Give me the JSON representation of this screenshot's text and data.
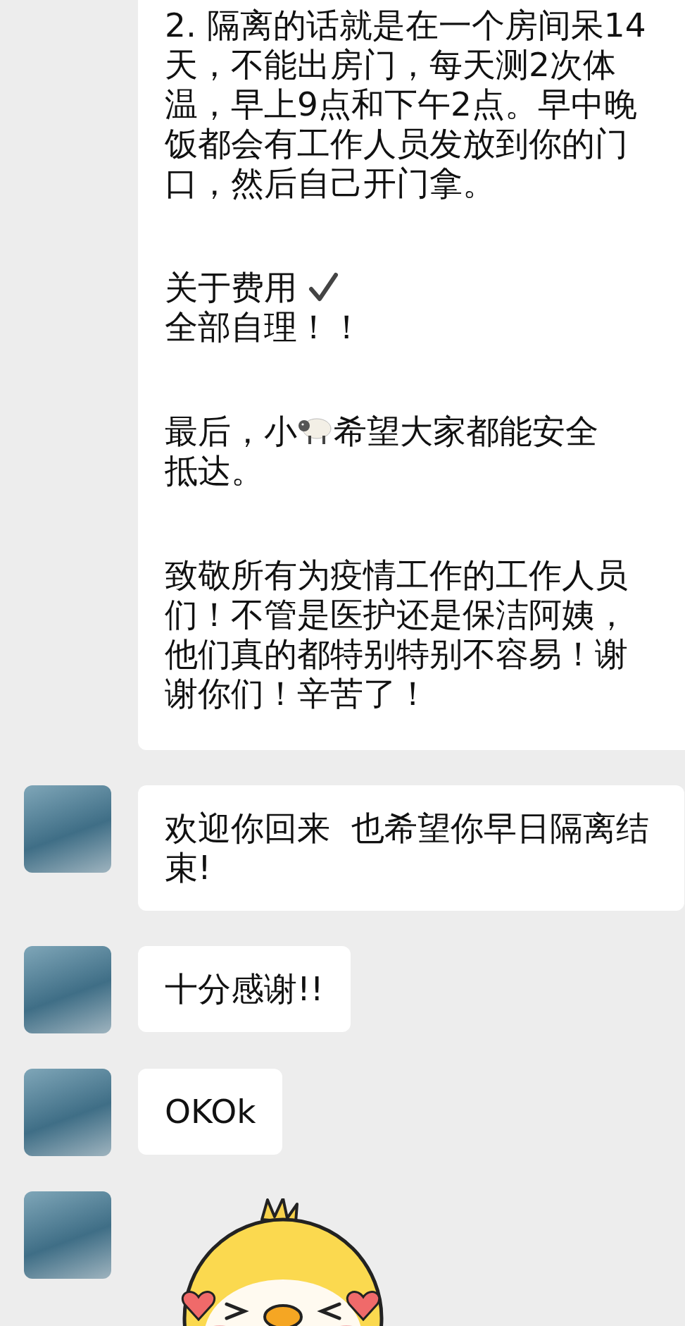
{
  "messages": [
    {
      "kind": "continued",
      "paragraphs": [
        {
          "lines": [
            {
              "kind": "text",
              "text": "2. 隔离的话就是在一个房间呆14天，不能出房门，每天测2次体温，早上9点和下午2点。早中晚饭都会有工作人员发放到你的门口，然后自己开门拿。"
            }
          ]
        },
        {
          "lines": [
            {
              "kind": "check",
              "text": "关于费用"
            },
            {
              "kind": "text",
              "text": "全部自理！！"
            }
          ]
        },
        {
          "lines": [
            {
              "kind": "sheep",
              "before": "最后，小",
              "after": "希望大家都能安全"
            },
            {
              "kind": "text",
              "text": "抵达。"
            }
          ]
        },
        {
          "lines": [
            {
              "kind": "text",
              "text": "致敬所有为疫情工作的工作人员们！不管是医护还是保洁阿姨，他们真的都特别特别不容易！谢谢你们！辛苦了！"
            }
          ]
        }
      ]
    },
    {
      "kind": "text",
      "text": "欢迎你回来  也希望你早日隔离结束!"
    },
    {
      "kind": "text",
      "text": "十分感谢!!"
    },
    {
      "kind": "text",
      "text": "OKOk"
    },
    {
      "kind": "sticker"
    }
  ]
}
